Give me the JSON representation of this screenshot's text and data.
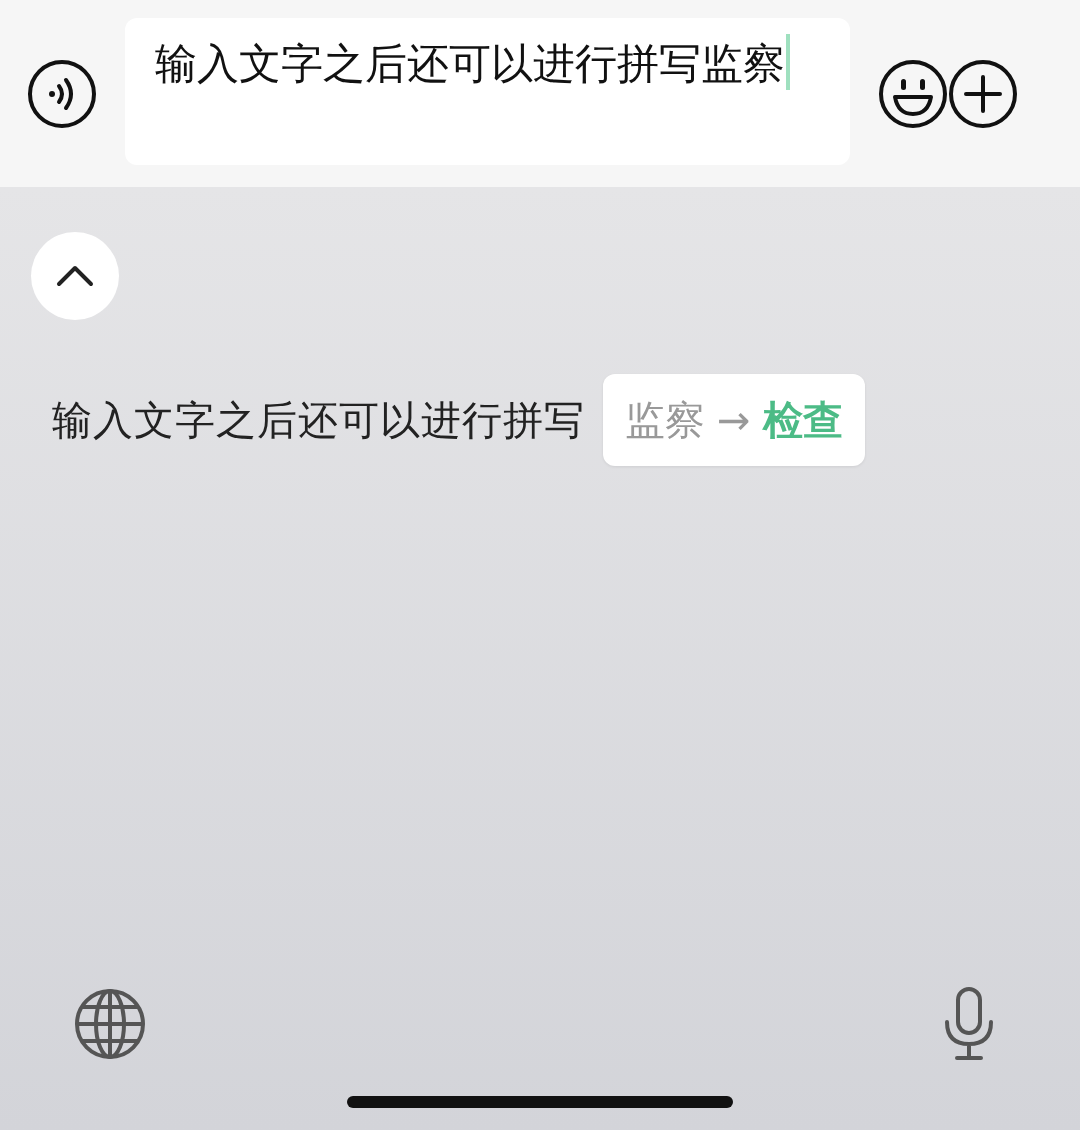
{
  "input_bar": {
    "value": "输入文字之后还可以进行拼写监察"
  },
  "suggestion": {
    "text": "输入文字之后还可以进行拼写",
    "correction": {
      "original": "监察",
      "arrow": "→",
      "replacement": "检查"
    }
  }
}
